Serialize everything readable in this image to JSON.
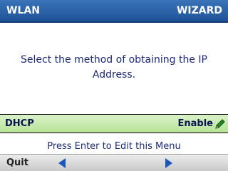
{
  "header": {
    "left_title": "WLAN",
    "right_title": "WIZARD"
  },
  "prompt": {
    "text": "Select the method of obtaining the IP Address."
  },
  "selected_option": {
    "label": "DHCP",
    "value": "Enable",
    "icon": "pencil-icon"
  },
  "hint": {
    "text": "Press Enter to Edit this Menu"
  },
  "softkeys": {
    "left_label": "Quit",
    "prev_icon": "arrow-left-icon",
    "next_icon": "arrow-right-icon"
  },
  "colors": {
    "header_bg": "#2b62a8",
    "row_bg": "#c8eba9",
    "text_dark_blue": "#1c2a78",
    "arrow_blue": "#1a57b8"
  }
}
